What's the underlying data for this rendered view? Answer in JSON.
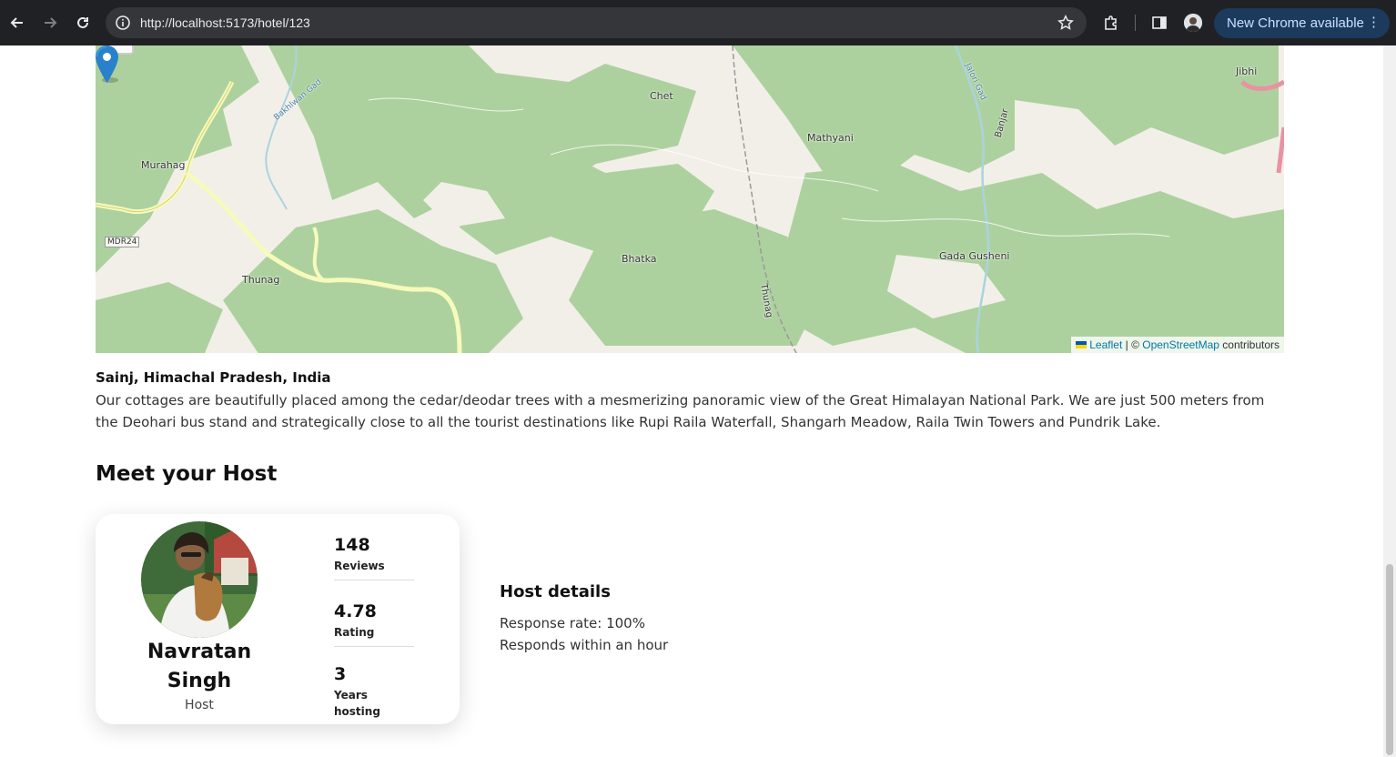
{
  "browser": {
    "url": "http://localhost:5173/hotel/123",
    "update_button": "New Chrome available"
  },
  "map": {
    "labels": [
      "Jibhi",
      "Chet",
      "Mathyani",
      "Murahag",
      "MDR24",
      "Thunag",
      "Bhatka",
      "Gada Gusheni",
      "Banjar",
      "Jalori Gad",
      "Bakhlwan Gad",
      "Thunag"
    ],
    "attribution": {
      "leaflet": "Leaflet",
      "separator": " | © ",
      "osm": "OpenStreetMap",
      "suffix": " contributors"
    }
  },
  "location": {
    "address": "Sainj, Himachal Pradesh, India",
    "description": "Our cottages are beautifully placed among the cedar/deodar trees with a mesmerizing panoramic view of the Great Himalayan National Park. We are just 500 meters from the Deohari bus stand and strategically close to all the tourist destinations like Rupi Raila Waterfall, Shangarh Meadow, Raila Twin Towers and Pundrik Lake."
  },
  "host": {
    "section_title": "Meet your Host",
    "first_name": "Navratan",
    "last_name": "Singh",
    "role": "Host",
    "stats": [
      {
        "value": "148",
        "label": "Reviews"
      },
      {
        "value": "4.78",
        "label": "Rating"
      },
      {
        "value": "3",
        "label": "Years hosting"
      }
    ],
    "details_title": "Host details",
    "response_rate": "Response rate: 100%",
    "response_time": "Responds within an hour"
  }
}
